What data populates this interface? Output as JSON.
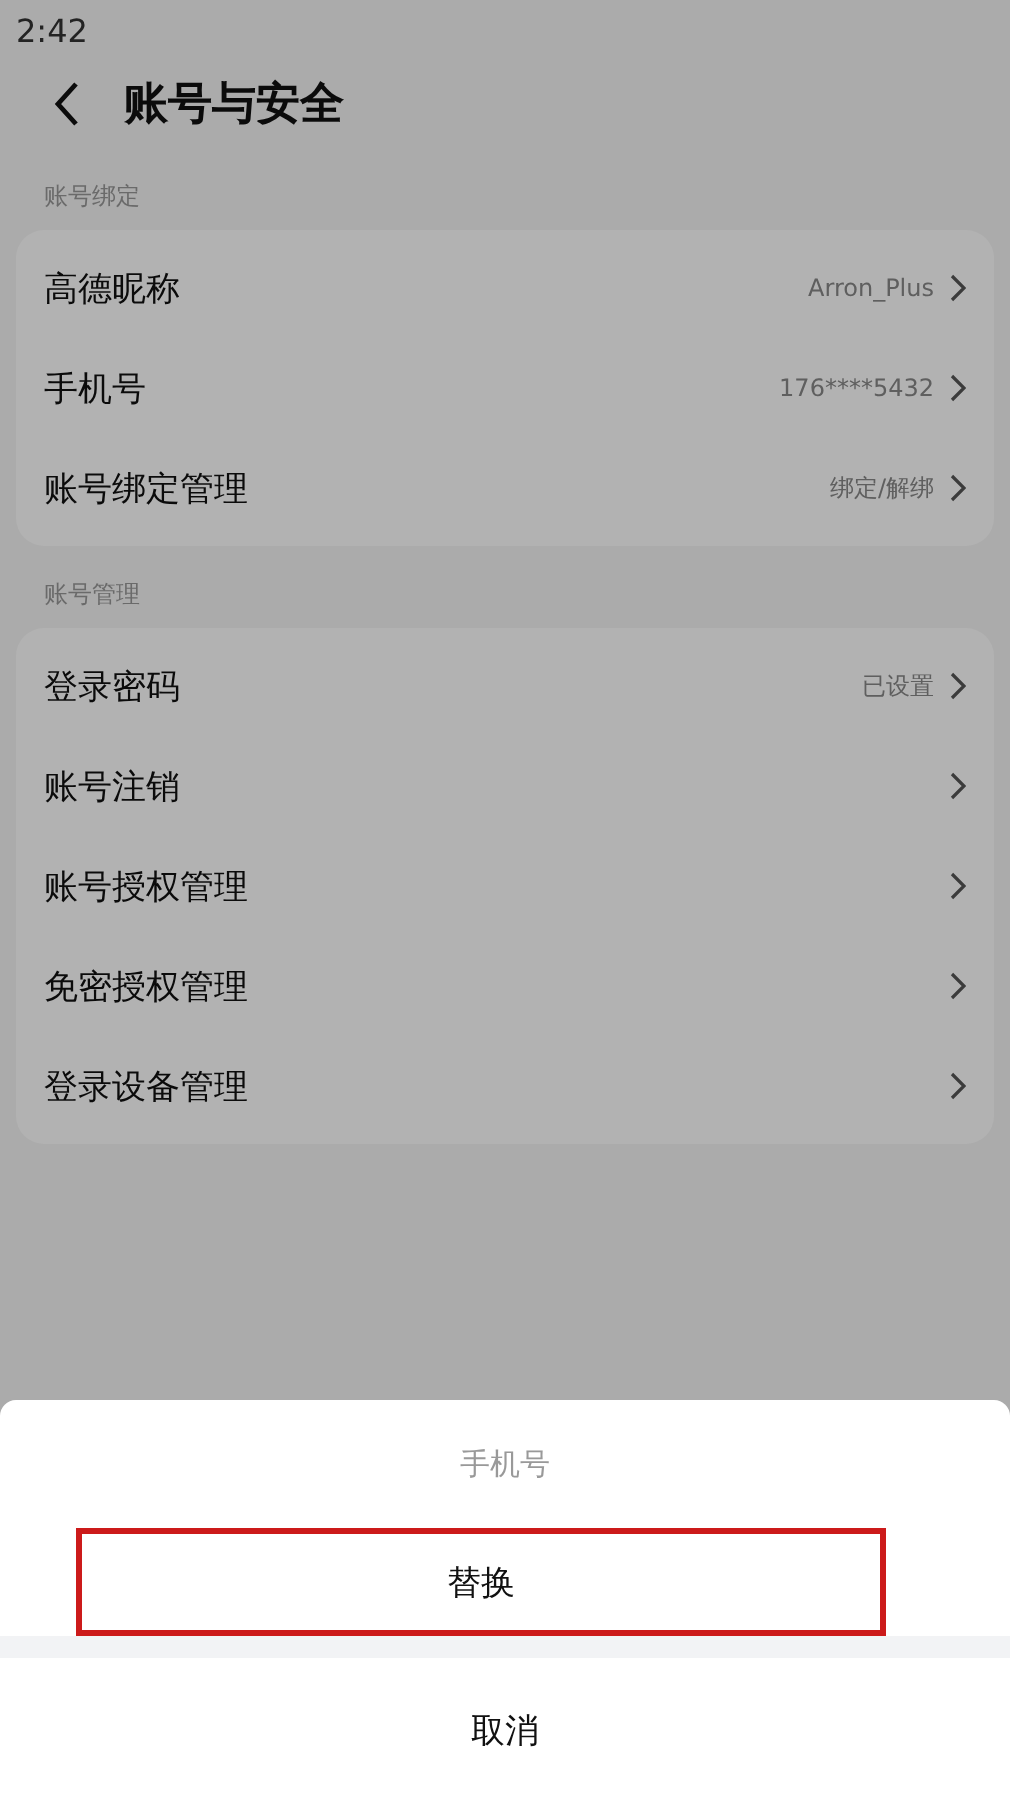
{
  "status_bar": {
    "time": "2:42"
  },
  "header": {
    "title": "账号与安全"
  },
  "sections": [
    {
      "label": "账号绑定",
      "rows": [
        {
          "label": "高德昵称",
          "value": "Arron_Plus"
        },
        {
          "label": "手机号",
          "value": "176****5432"
        },
        {
          "label": "账号绑定管理",
          "value": "绑定/解绑"
        }
      ]
    },
    {
      "label": "账号管理",
      "rows": [
        {
          "label": "登录密码",
          "value": "已设置"
        },
        {
          "label": "账号注销"
        },
        {
          "label": "账号授权管理"
        },
        {
          "label": "免密授权管理"
        },
        {
          "label": "登录设备管理"
        }
      ]
    }
  ],
  "action_sheet": {
    "title": "手机号",
    "actions": [
      {
        "label": "替换",
        "highlighted": true
      }
    ],
    "cancel": "取消"
  }
}
